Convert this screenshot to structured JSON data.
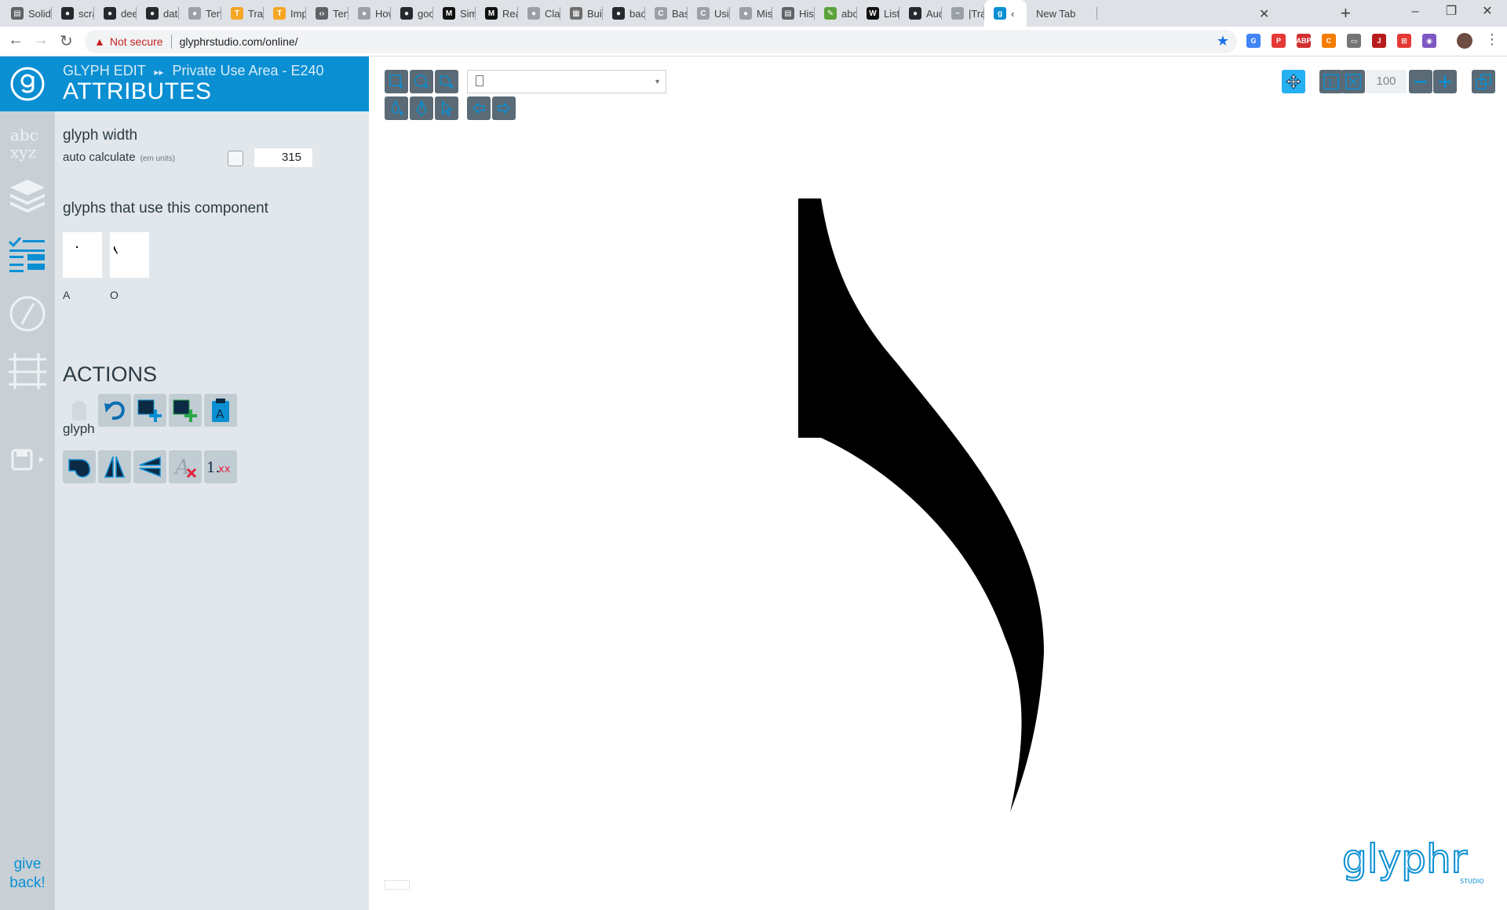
{
  "browser": {
    "tabs": [
      {
        "label": "Solid",
        "color": "#5f6368",
        "glyph": "▤"
      },
      {
        "label": "scrap",
        "color": "#24292e",
        "glyph": "●"
      },
      {
        "label": "deep",
        "color": "#24292e",
        "glyph": "●"
      },
      {
        "label": "data-",
        "color": "#24292e",
        "glyph": "●"
      },
      {
        "label": "Tenso",
        "color": "#9aa0a6",
        "glyph": "●"
      },
      {
        "label": "Trans",
        "color": "#f5a623",
        "glyph": "T"
      },
      {
        "label": "Impo",
        "color": "#f5a623",
        "glyph": "T"
      },
      {
        "label": "Tenso",
        "color": "#5f6368",
        "glyph": "‹›"
      },
      {
        "label": "How",
        "color": "#9aa0a6",
        "glyph": "●"
      },
      {
        "label": "goog",
        "color": "#24292e",
        "glyph": "●"
      },
      {
        "label": "Simp",
        "color": "#111111",
        "glyph": "M"
      },
      {
        "label": "Realt",
        "color": "#111111",
        "glyph": "M"
      },
      {
        "label": "Class",
        "color": "#9aa0a6",
        "glyph": "●"
      },
      {
        "label": "Build",
        "color": "#6d6d6d",
        "glyph": "▦"
      },
      {
        "label": "bacti",
        "color": "#24292e",
        "glyph": "●"
      },
      {
        "label": "Basic",
        "color": "#9aa0a6",
        "glyph": "C"
      },
      {
        "label": "Using",
        "color": "#9aa0a6",
        "glyph": "C"
      },
      {
        "label": "Misc",
        "color": "#9aa0a6",
        "glyph": "●"
      },
      {
        "label": "Histo",
        "color": "#5f6368",
        "glyph": "▤"
      },
      {
        "label": "abcs",
        "color": "#5aa33a",
        "glyph": "✎"
      },
      {
        "label": "List o",
        "color": "#111111",
        "glyph": "W"
      },
      {
        "label": "Audi",
        "color": "#24292e",
        "glyph": "●"
      },
      {
        "label": "|Trac",
        "color": "#9aa0a6",
        "glyph": "~"
      },
      {
        "label": "‹",
        "color": "#0a8fd3",
        "glyph": "g"
      },
      {
        "label": "New Tab",
        "color": "#dee1e6",
        "glyph": ""
      }
    ],
    "active_tab_index": 23,
    "url_warning": "Not secure",
    "url": "glyphrstudio.com/online/",
    "window_buttons": [
      "–",
      "❐",
      "✕"
    ],
    "new_tab_symbol": "+",
    "extensions": [
      {
        "name": "translate-ext-icon",
        "color": "#4285f4",
        "glyph": "G"
      },
      {
        "name": "pdf-ext-icon",
        "color": "#e53935",
        "glyph": "P"
      },
      {
        "name": "adblock-ext-icon",
        "color": "#d32f2f",
        "glyph": "ABP"
      },
      {
        "name": "honey-ext-icon",
        "color": "#f57c00",
        "glyph": "C"
      },
      {
        "name": "cast-ext-icon",
        "color": "#757575",
        "glyph": "▭"
      },
      {
        "name": "red-ext-icon",
        "color": "#b71c1c",
        "glyph": "J"
      },
      {
        "name": "cart-ext-icon",
        "color": "#e53935",
        "glyph": "⊞"
      },
      {
        "name": "purple-ext-icon",
        "color": "#7e57c2",
        "glyph": "◉"
      }
    ]
  },
  "app": {
    "accent": "#0a8fd3",
    "breadcrumb": {
      "section": "GLYPH EDIT",
      "separator": "▸▸",
      "location": "Private Use Area - E240"
    },
    "panel_title": "ATTRIBUTES",
    "glyph_width": {
      "heading": "glyph width",
      "auto_label": "auto calculate",
      "units_note": "(em units)",
      "auto_checked": false,
      "value": "315"
    },
    "usage": {
      "heading": "glyphs that use this component",
      "glyphs": [
        {
          "label": "A"
        },
        {
          "label": "O"
        }
      ]
    },
    "actions": {
      "heading": "ACTIONS",
      "glyph_heading": "glyph"
    },
    "zoom": "100",
    "give_back": [
      "give",
      "back!"
    ],
    "brand": "glyphr",
    "brand_sub": "STUDIO"
  }
}
